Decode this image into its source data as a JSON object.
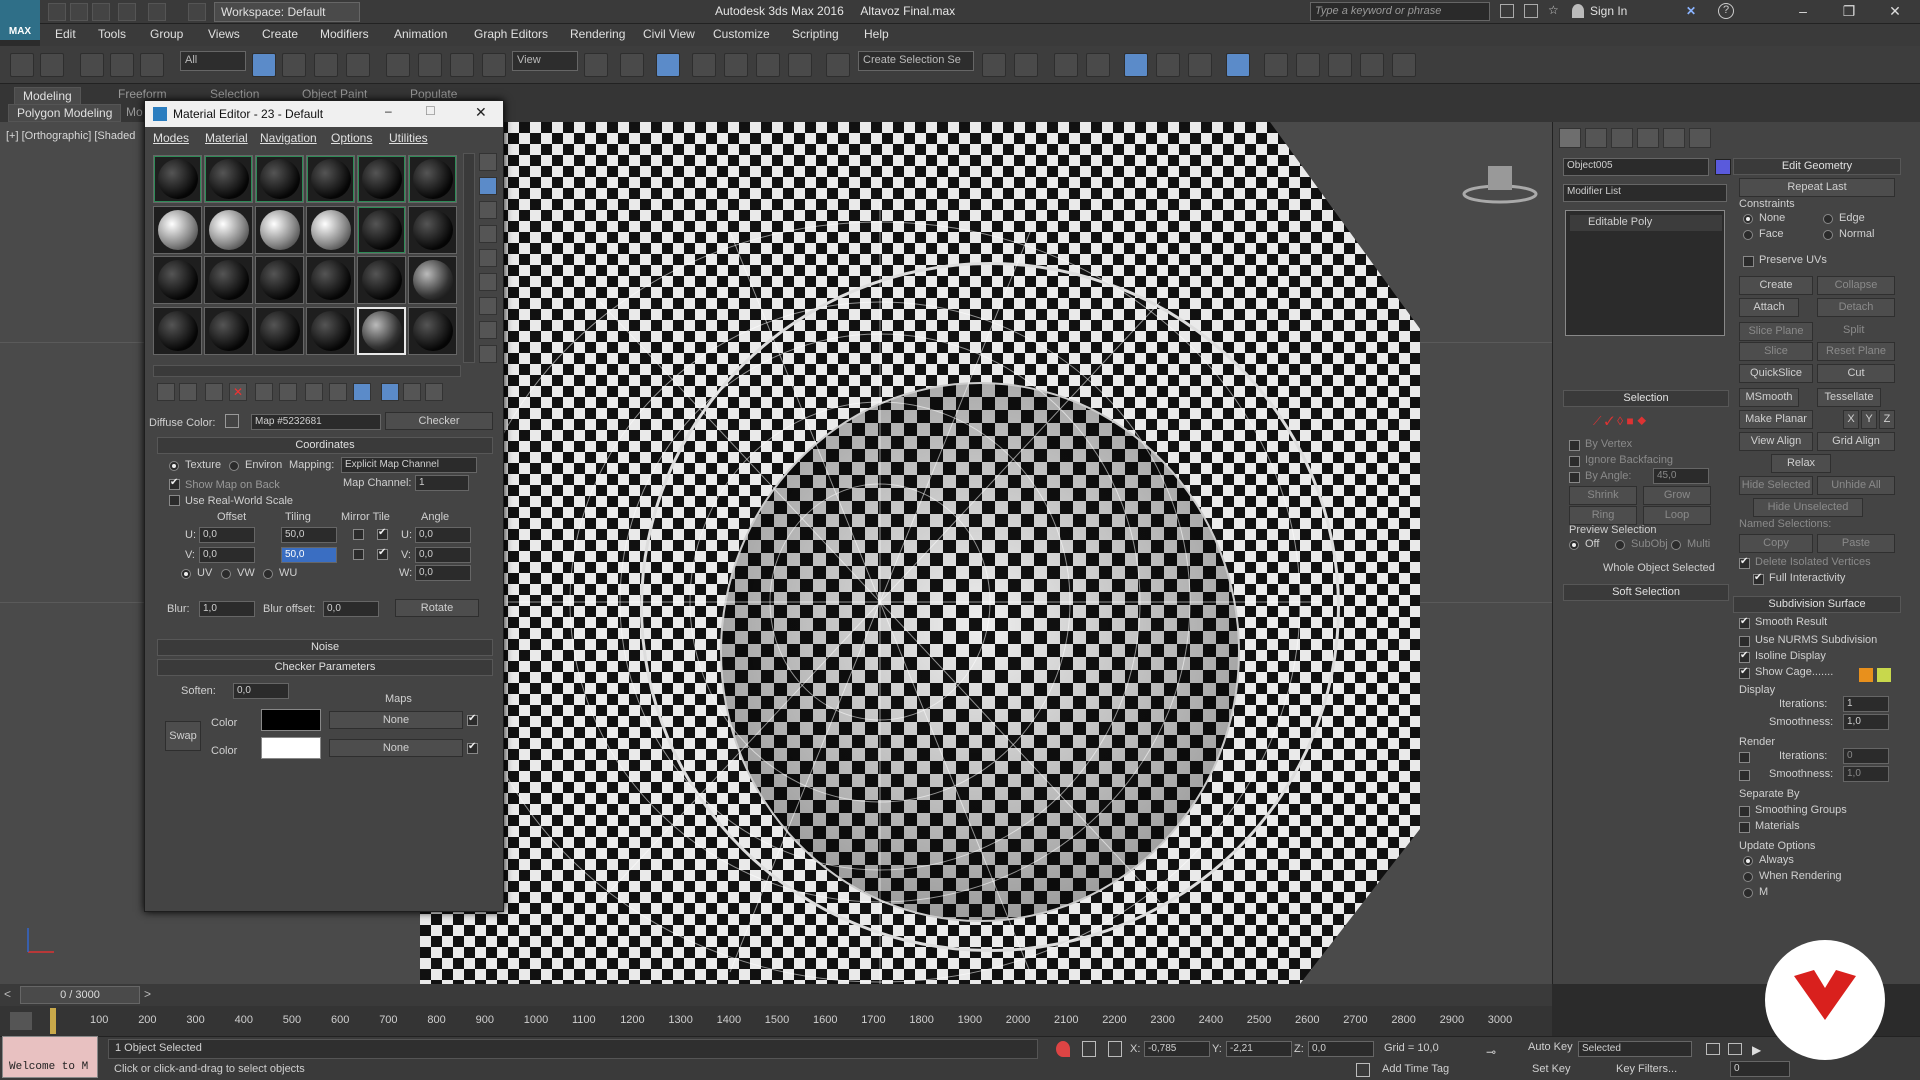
{
  "app": {
    "title": "Autodesk 3ds Max 2016",
    "file": "Altavoz Final.max",
    "logo_text": "MAX",
    "workspace": "Workspace: Default",
    "search_placeholder": "Type a keyword or phrase",
    "sign_in": "Sign In"
  },
  "menus": [
    "Edit",
    "Tools",
    "Group",
    "Views",
    "Create",
    "Modifiers",
    "Animation",
    "Graph Editors",
    "Rendering",
    "Civil View",
    "Customize",
    "Scripting",
    "Help"
  ],
  "toolbar": {
    "selection_filter": "All",
    "ref_coord": "View",
    "named_selection": "Create Selection Se"
  },
  "ribbon": {
    "tabs": [
      "Modeling",
      "Freeform",
      "Selection",
      "Object Paint",
      "Populate"
    ],
    "active": "Modeling",
    "subtab": "Polygon Modeling",
    "subtab2": "Mo"
  },
  "viewport": {
    "label": "[+] [Orthographic] [Shaded"
  },
  "material_editor": {
    "title": "Material Editor - 23 - Default",
    "menus": [
      "Modes",
      "Material",
      "Navigation",
      "Options",
      "Utilities"
    ],
    "diffuse_label": "Diffuse Color:",
    "map_name": "Map #5232681",
    "map_type": "Checker",
    "coordinates": {
      "header": "Coordinates",
      "texture": "Texture",
      "environ": "Environ",
      "mapping_label": "Mapping:",
      "mapping": "Explicit Map Channel",
      "show_map_on_back": "Show Map on Back",
      "map_channel_label": "Map Channel:",
      "map_channel": "1",
      "real_world": "Use Real-World Scale",
      "col_offset": "Offset",
      "col_tiling": "Tiling",
      "col_mirror": "Mirror Tile",
      "col_angle": "Angle",
      "u_offset": "0,0",
      "u_tiling": "50,0",
      "v_offset": "0,0",
      "v_tiling": "50,0",
      "u_angle": "0,0",
      "v_angle": "0,0",
      "w_angle": "0,0",
      "u": "U:",
      "v": "V:",
      "w": "W:",
      "uv": "UV",
      "vw": "VW",
      "wu": "WU",
      "blur_label": "Blur:",
      "blur": "1,0",
      "blur_offset_label": "Blur offset:",
      "blur_offset": "0,0",
      "rotate": "Rotate"
    },
    "noise_header": "Noise",
    "checker_header": "Checker Parameters",
    "soften_label": "Soften:",
    "soften": "0,0",
    "maps_label": "Maps",
    "swap": "Swap",
    "color1_label": "Color",
    "color2_label": "Color",
    "map1": "None",
    "map2": "None",
    "color1": "#000000",
    "color2": "#ffffff"
  },
  "command_panel": {
    "object_name": "Object005",
    "object_color": "#5a5adc",
    "modifier_list": "Modifier List",
    "stack_item": "Editable Poly",
    "selection_header": "Selection",
    "by_vertex": "By Vertex",
    "ignore_backfacing": "Ignore Backfacing",
    "by_angle": "By Angle:",
    "angle": "45,0",
    "shrink": "Shrink",
    "grow": "Grow",
    "ring": "Ring",
    "loop": "Loop",
    "preview_selection": "Preview Selection",
    "off": "Off",
    "subobj": "SubObj",
    "multi": "Multi",
    "whole_object": "Whole Object Selected",
    "soft_selection": "Soft Selection",
    "edit_geometry": "Edit Geometry",
    "repeat_last": "Repeat Last",
    "constraints": "Constraints",
    "none": "None",
    "edge": "Edge",
    "face": "Face",
    "normal": "Normal",
    "preserve_uvs": "Preserve UVs",
    "create": "Create",
    "collapse": "Collapse",
    "attach": "Attach",
    "detach": "Detach",
    "slice_plane": "Slice Plane",
    "split": "Split",
    "slice": "Slice",
    "reset_plane": "Reset Plane",
    "quickslice": "QuickSlice",
    "cut": "Cut",
    "msmooth": "MSmooth",
    "tessellate": "Tessellate",
    "make_planar": "Make Planar",
    "x": "X",
    "y": "Y",
    "z": "Z",
    "view_align": "View Align",
    "grid_align": "Grid Align",
    "relax": "Relax",
    "hide_selected": "Hide Selected",
    "unhide_all": "Unhide All",
    "hide_unselected": "Hide Unselected",
    "named_selections": "Named Selections:",
    "copy": "Copy",
    "paste": "Paste",
    "delete_isolated": "Delete Isolated Vertices",
    "full_interactivity": "Full Interactivity",
    "subdivision_surface": "Subdivision Surface",
    "smooth_result": "Smooth Result",
    "use_nurms": "Use NURMS Subdivision",
    "isoline": "Isoline Display",
    "show_cage": "Show Cage.......",
    "cage_color1": "#e8901c",
    "cage_color2": "#c8d84c",
    "display": "Display",
    "iterations": "Iterations:",
    "iter_val": "1",
    "smoothness": "Smoothness:",
    "smooth_val": "1,0",
    "render": "Render",
    "r_iter_val": "0",
    "r_smooth_val": "1,0",
    "separate_by": "Separate By",
    "smoothing_groups": "Smoothing Groups",
    "materials": "Materials",
    "update_options": "Update Options",
    "always": "Always",
    "when_rendering": "When Rendering",
    "manually": "M"
  },
  "timeline": {
    "frame": "0 / 3000",
    "ticks": [
      "100",
      "200",
      "300",
      "400",
      "500",
      "600",
      "700",
      "800",
      "900",
      "1000",
      "1100",
      "1200",
      "1300",
      "1400",
      "1500",
      "1600",
      "1700",
      "1800",
      "1900",
      "2000",
      "2100",
      "2200",
      "2300",
      "2400",
      "2500",
      "2600",
      "2700",
      "2800",
      "2900",
      "3000"
    ]
  },
  "status": {
    "welcome": "Welcome to M",
    "objects_selected": "1 Object Selected",
    "prompt": "Click or click-and-drag to select objects",
    "x_label": "X:",
    "x": "-0,785",
    "y_label": "Y:",
    "y": "-2,21",
    "z_label": "Z:",
    "z": "0,0",
    "grid": "Grid = 10,0",
    "add_time_tag": "Add Time Tag",
    "auto_key": "Auto Key",
    "set_key": "Set Key",
    "selected": "Selected",
    "key_filters": "Key Filters...",
    "frame_val": "0"
  }
}
